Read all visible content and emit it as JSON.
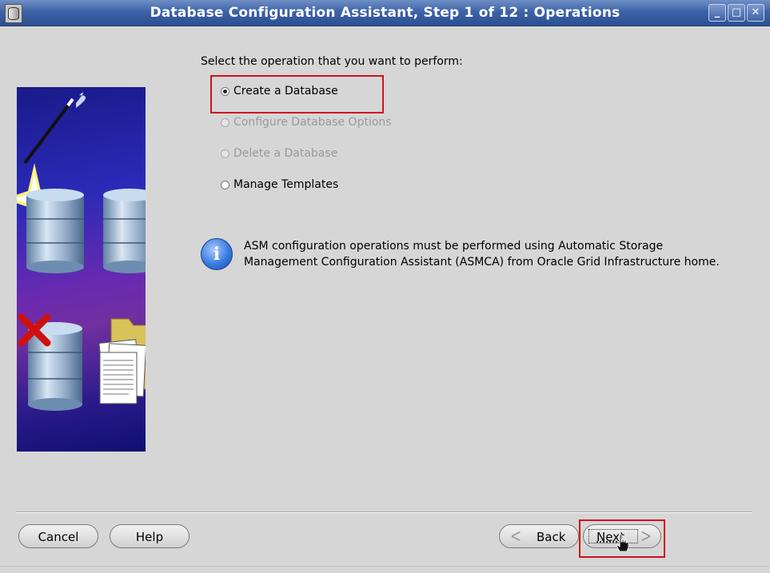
{
  "window": {
    "title": "Database Configuration Assistant, Step 1 of 12 : Operations",
    "controls": {
      "minimize": "_",
      "maximize": "□",
      "close": "✕"
    }
  },
  "main": {
    "prompt": "Select the operation that you want to perform:",
    "options": [
      {
        "label": "Create a Database",
        "selected": true,
        "enabled": true
      },
      {
        "label": "Configure Database Options",
        "selected": false,
        "enabled": false
      },
      {
        "label": "Delete a Database",
        "selected": false,
        "enabled": false
      },
      {
        "label": "Manage Templates",
        "selected": false,
        "enabled": true
      }
    ],
    "info": {
      "icon": "info-icon",
      "glyph": "i",
      "line1": "ASM configuration operations must be performed using Automatic Storage",
      "line2": "Management Configuration Assistant (ASMCA) from Oracle Grid Infrastructure home."
    }
  },
  "footer": {
    "cancel_label": "Cancel",
    "help_label": "Help",
    "back_label": "Back",
    "next_label": "Next",
    "back_chevron": "ᐸ",
    "next_chevron": "ᐳ"
  },
  "colors": {
    "titlebar": "#3d63a8",
    "highlight": "#d0101a",
    "window_bg": "#d6d6d6"
  }
}
